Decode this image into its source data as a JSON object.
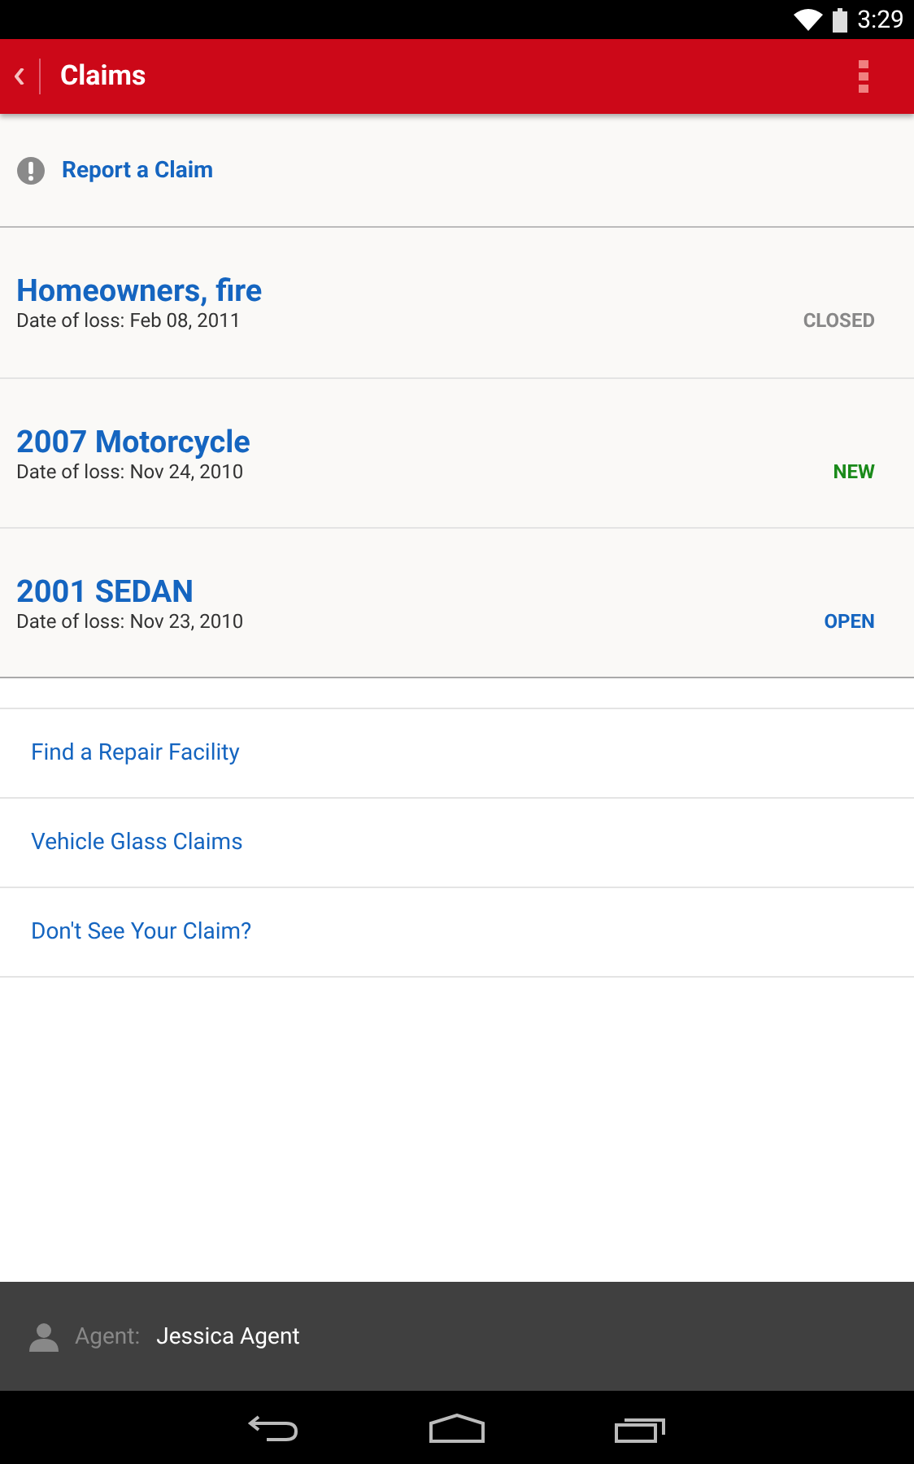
{
  "status_bar": {
    "time": "3:29"
  },
  "app_bar": {
    "title": "Claims"
  },
  "report": {
    "label": "Report a Claim"
  },
  "claims": [
    {
      "title": "Homeowners, fire",
      "date": "Date of loss: Feb 08, 2011",
      "status": "CLOSED",
      "color": "#888888"
    },
    {
      "title": "2007 Motorcycle",
      "date": "Date of loss: Nov 24, 2010",
      "status": "NEW",
      "color": "#1a8a1a"
    },
    {
      "title": "2001 SEDAN",
      "date": "Date of loss: Nov 23, 2010",
      "status": "OPEN",
      "color": "#1565c0"
    }
  ],
  "links": [
    "Find a Repair Facility",
    "Vehicle Glass Claims",
    "Don't See Your Claim?"
  ],
  "agent": {
    "label": "Agent:",
    "name": "Jessica Agent"
  }
}
